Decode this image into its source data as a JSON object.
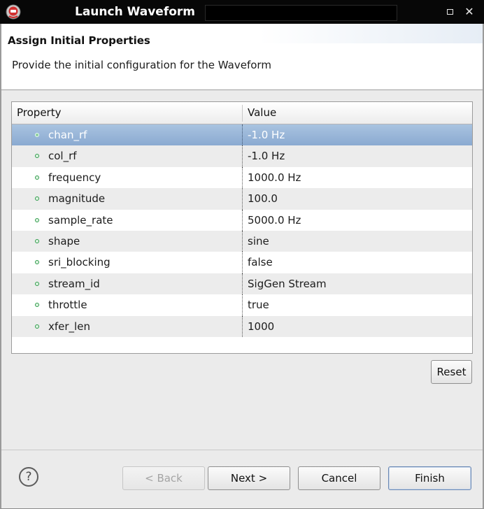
{
  "window": {
    "title": "Launch Waveform",
    "maximize_glyph": "maximize-icon",
    "close_glyph": "✕"
  },
  "header": {
    "title": "Assign Initial Properties",
    "description": "Provide the initial configuration for the Waveform"
  },
  "table": {
    "columns": [
      "Property",
      "Value"
    ],
    "rows": [
      {
        "property": "chan_rf",
        "value": "-1.0 Hz"
      },
      {
        "property": "col_rf",
        "value": "-1.0 Hz"
      },
      {
        "property": "frequency",
        "value": "1000.0 Hz"
      },
      {
        "property": "magnitude",
        "value": "100.0"
      },
      {
        "property": "sample_rate",
        "value": "5000.0 Hz"
      },
      {
        "property": "shape",
        "value": "sine"
      },
      {
        "property": "sri_blocking",
        "value": "false"
      },
      {
        "property": "stream_id",
        "value": "SigGen Stream"
      },
      {
        "property": "throttle",
        "value": "true"
      },
      {
        "property": "xfer_len",
        "value": "1000"
      }
    ],
    "selected_row": "chan_rf"
  },
  "buttons": {
    "reset": "Reset",
    "help": "?",
    "back": "< Back",
    "next": "Next >",
    "cancel": "Cancel",
    "finish": "Finish"
  },
  "colors": {
    "selection": "#8aaad1",
    "bullet": "#2f9c4a",
    "titlebar": "#070707"
  }
}
